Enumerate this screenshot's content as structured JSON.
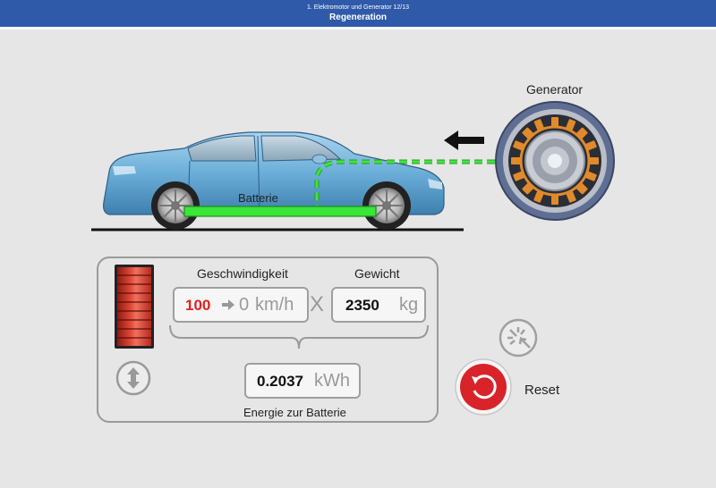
{
  "header": {
    "subtitle": "1. Elektromotor und Generator 12/13",
    "title": "Regeneration"
  },
  "scene": {
    "generator_label": "Generator",
    "battery_label": "Batterie"
  },
  "panel": {
    "speed_label": "Geschwindigkeit",
    "speed_from": "100",
    "speed_to": "0",
    "speed_unit": "km/h",
    "multiply": "X",
    "weight_label": "Gewicht",
    "weight_value": "2350",
    "weight_unit": "kg",
    "energy_value": "0.2037",
    "energy_unit": "kWh",
    "energy_label": "Energie zur Batterie"
  },
  "controls": {
    "reset_label": "Reset"
  },
  "colors": {
    "header": "#2f5aa9",
    "battery": "#39e639",
    "energy_flow": "#39c939",
    "speed_from": "#e02020",
    "reset": "#d8232a",
    "slider": "#d63a2e"
  }
}
